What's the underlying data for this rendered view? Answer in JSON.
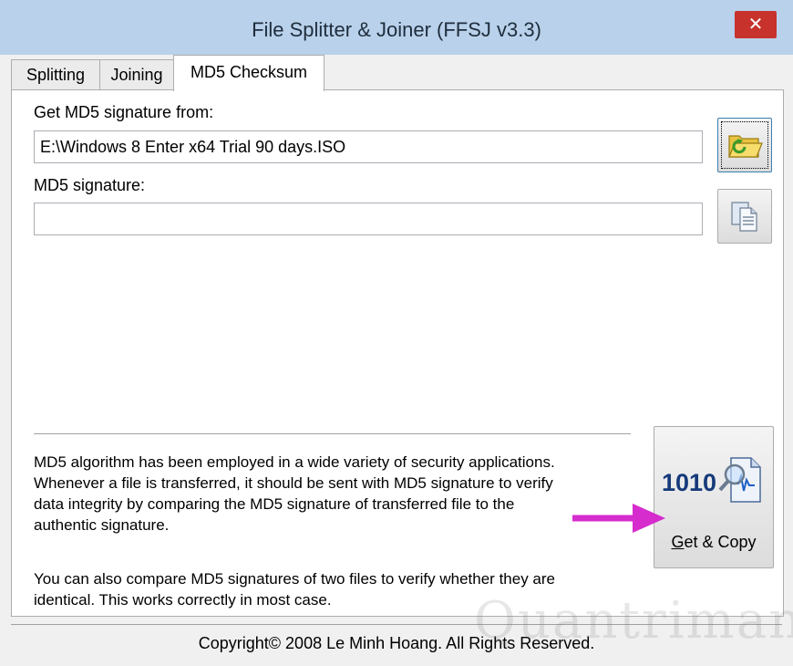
{
  "window": {
    "title": "File Splitter & Joiner (FFSJ v3.3)",
    "close_symbol": "✕"
  },
  "tabs": [
    {
      "label": "Splitting",
      "active": false
    },
    {
      "label": "Joining",
      "active": false
    },
    {
      "label": "MD5 Checksum",
      "active": true
    }
  ],
  "source": {
    "label": "Get MD5 signature from:",
    "value": "E:\\Windows 8 Enter x64 Trial 90 days.ISO",
    "browse_icon": "folder-open-icon"
  },
  "signature": {
    "label": "MD5 signature:",
    "value": "",
    "copy_icon": "copy-document-icon"
  },
  "description": {
    "line1": "MD5 algorithm has been employed in a wide variety of security applications.",
    "line2": "Whenever a file is transferred, it should be sent with MD5 signature to verify",
    "line3": "data integrity by comparing the MD5 signature of transferred file to the",
    "line4": "authentic signature.",
    "line5": "You can also compare MD5 signatures of two files to verify whether they are",
    "line6": "identical. This works correctly in most case."
  },
  "action_button": {
    "label": "Get & Copy",
    "icon_text": "1010",
    "icon": "binary-magnifier-document-icon"
  },
  "annotation": {
    "arrow_color": "#d62ccd"
  },
  "footer": {
    "copyright": "Copyright© 2008 Le Minh Hoang. All Rights Reserved."
  },
  "watermark": {
    "text": "Quantrimang"
  },
  "colors": {
    "titlebar": "#b9d1ea",
    "close": "#c7322c",
    "accent": "#3c7fb1"
  }
}
